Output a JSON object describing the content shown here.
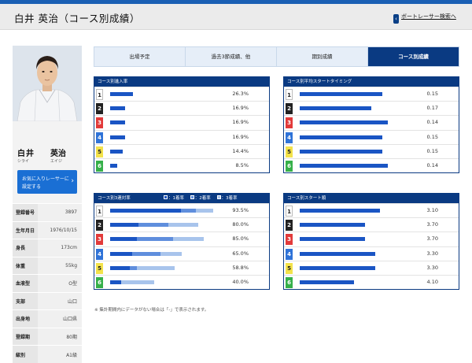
{
  "header": {
    "title": "白井 英治（コース別成績）",
    "back_link": "ボートレーサー検索へ",
    "back_arrow": "‹"
  },
  "profile": {
    "surname": "白井",
    "given": "英治",
    "kana_surname": "シライ",
    "kana_given": "エイジ",
    "fav_line1": "お気に入りレーサーに",
    "fav_line2": "設定する",
    "fav_chevron": "›",
    "info": [
      {
        "k": "登録番号",
        "v": "3897"
      },
      {
        "k": "生年月日",
        "v": "1976/10/15"
      },
      {
        "k": "身長",
        "v": "173cm"
      },
      {
        "k": "体重",
        "v": "55kg"
      },
      {
        "k": "血液型",
        "v": "O型"
      },
      {
        "k": "支部",
        "v": "山口"
      },
      {
        "k": "出身地",
        "v": "山口県"
      },
      {
        "k": "登録期",
        "v": "80期"
      },
      {
        "k": "級別",
        "v": "A1級"
      }
    ]
  },
  "tabs": [
    "出場予定",
    "過去3節成績、他",
    "期別成績",
    "コース別成績"
  ],
  "lane_colors": {
    "1": "#ffffff",
    "2": "#222222",
    "3": "#e23a3a",
    "4": "#2f73d8",
    "5": "#f3e24a",
    "6": "#36b04a"
  },
  "entry": {
    "title": "コース別進入率",
    "rows": [
      {
        "course": "1",
        "value": "26.3%",
        "rate": 26.3
      },
      {
        "course": "2",
        "value": "16.9%",
        "rate": 16.9
      },
      {
        "course": "3",
        "value": "16.9%",
        "rate": 16.9
      },
      {
        "course": "4",
        "value": "16.9%",
        "rate": 16.9
      },
      {
        "course": "5",
        "value": "14.4%",
        "rate": 14.4
      },
      {
        "course": "6",
        "value": "8.5%",
        "rate": 8.5
      }
    ]
  },
  "timing": {
    "title": "コース別平均スタートタイミング",
    "rows": [
      {
        "course": "1",
        "value": "0.15"
      },
      {
        "course": "2",
        "value": "0.17"
      },
      {
        "course": "3",
        "value": "0.14"
      },
      {
        "course": "4",
        "value": "0.15"
      },
      {
        "course": "5",
        "value": "0.15"
      },
      {
        "course": "6",
        "value": "0.14"
      }
    ]
  },
  "rentai": {
    "title": "コース別3連対率",
    "legend": [
      "1着率",
      "2着率",
      "3着率"
    ],
    "rows": [
      {
        "course": "1",
        "value": "93.5%",
        "a": 64,
        "b": 14,
        "c": 15.5
      },
      {
        "course": "2",
        "value": "80.0%",
        "a": 26,
        "b": 27,
        "c": 27
      },
      {
        "course": "3",
        "value": "85.0%",
        "a": 24,
        "b": 33,
        "c": 28
      },
      {
        "course": "4",
        "value": "65.0%",
        "a": 20,
        "b": 26,
        "c": 19
      },
      {
        "course": "5",
        "value": "58.8%",
        "a": 18,
        "b": 6,
        "c": 34.8
      },
      {
        "course": "6",
        "value": "40.0%",
        "a": 10,
        "b": 0,
        "c": 30
      }
    ]
  },
  "startorder": {
    "title": "コース別スタート順",
    "rows": [
      {
        "course": "1",
        "value": "3.10"
      },
      {
        "course": "2",
        "value": "3.70"
      },
      {
        "course": "3",
        "value": "3.70"
      },
      {
        "course": "4",
        "value": "3.30"
      },
      {
        "course": "5",
        "value": "3.30"
      },
      {
        "course": "6",
        "value": "4.10"
      }
    ]
  },
  "note": "※ 集計期間内にデータがない場合は「-」で表示されます。"
}
